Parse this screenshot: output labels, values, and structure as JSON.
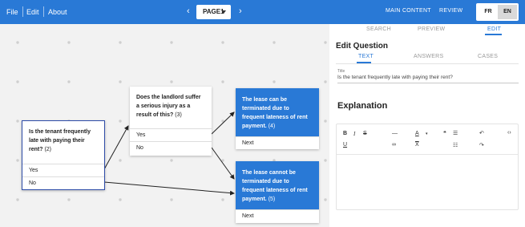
{
  "menu": {
    "file": "File",
    "edit": "Edit",
    "about": "About"
  },
  "pager": {
    "prev": "‹",
    "next": "›",
    "current": "PAGE1"
  },
  "view_tabs": {
    "main": "MAIN CONTENT",
    "review": "REVIEW"
  },
  "languages": {
    "fr": "FR",
    "en": "EN",
    "active": "EN"
  },
  "graph": {
    "tenant": {
      "question": "Is the tenant frequently late with paying their rent?",
      "number": "(2)",
      "options": [
        "Yes",
        "No"
      ]
    },
    "landlord": {
      "question": "Does the landlord suffer a serious injury as a result of this?",
      "number": "(3)",
      "options": [
        "Yes",
        "No"
      ]
    },
    "outcome4": {
      "text": "The lease can be terminated due to frequent lateness of rent payment.",
      "number": "(4)",
      "next": "Next"
    },
    "outcome5": {
      "text": "The lease cannot be terminated due to frequent lateness of rent payment.",
      "number": "(5)",
      "next": "Next"
    }
  },
  "panel": {
    "tabs": {
      "search": "SEARCH",
      "preview": "PREVIEW",
      "edit": "EDIT"
    },
    "title": "Edit Question",
    "subtabs": {
      "text": "TEXT",
      "answers": "ANSWERS",
      "cases": "CASES"
    },
    "field_label": "Title",
    "field_value": "Is the tenant frequently late with paying their rent?",
    "explanation_title": "Explanation",
    "toolbar": {
      "bold": "B",
      "italic": "I",
      "strike": "S",
      "hr": "—",
      "color": "A",
      "color_caret": "▾",
      "quote": "❝",
      "bullets": "☰",
      "undo": "↶",
      "code": "‹›",
      "underline": "U",
      "link": "∞",
      "clear": "X",
      "numbered": "☷",
      "redo": "↷"
    }
  },
  "colors": {
    "accent": "#2979d6",
    "canvas_bg": "#f2f2f2",
    "connector": "#222222"
  }
}
